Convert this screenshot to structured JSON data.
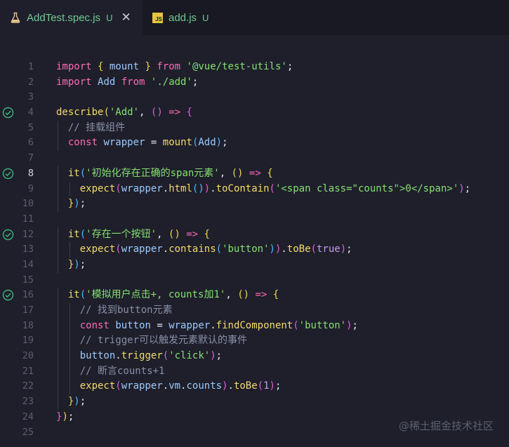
{
  "tabs": [
    {
      "name": "AddTest.spec.js",
      "status": "U",
      "active": true
    },
    {
      "name": "add.js",
      "status": "U",
      "active": false
    }
  ],
  "icons": {
    "test_file": "flask-icon",
    "js_file": "js-file-icon",
    "test_pass": "check-circle-icon",
    "close": "close-icon"
  },
  "js_icon_text": "JS",
  "current_line": 8,
  "lines": [
    {
      "n": "1",
      "t": "import { mount } from '@vue/test-utils';"
    },
    {
      "n": "2",
      "t": "import Add from './add';"
    },
    {
      "n": "3",
      "t": ""
    },
    {
      "n": "4",
      "t": "describe('Add', () => {",
      "pass": true
    },
    {
      "n": "5",
      "t": "  // 挂载组件"
    },
    {
      "n": "6",
      "t": "  const wrapper = mount(Add);"
    },
    {
      "n": "7",
      "t": ""
    },
    {
      "n": "8",
      "t": "  it('初始化存在正确的span元素', () => {",
      "pass": true
    },
    {
      "n": "9",
      "t": "    expect(wrapper.html()).toContain('<span class=\"counts\">0</span>');"
    },
    {
      "n": "10",
      "t": "  });"
    },
    {
      "n": "11",
      "t": ""
    },
    {
      "n": "12",
      "t": "  it('存在一个按钮', () => {",
      "pass": true
    },
    {
      "n": "13",
      "t": "    expect(wrapper.contains('button')).toBe(true);"
    },
    {
      "n": "14",
      "t": "  });"
    },
    {
      "n": "15",
      "t": ""
    },
    {
      "n": "16",
      "t": "  it('模拟用户点击+, counts加1', () => {",
      "pass": true
    },
    {
      "n": "17",
      "t": "    // 找到button元素"
    },
    {
      "n": "18",
      "t": "    const button = wrapper.findComponent('button');"
    },
    {
      "n": "19",
      "t": "    // trigger可以触发元素默认的事件"
    },
    {
      "n": "20",
      "t": "    button.trigger('click');"
    },
    {
      "n": "21",
      "t": "    // 断言counts+1"
    },
    {
      "n": "22",
      "t": "    expect(wrapper.vm.counts).toBe(1);"
    },
    {
      "n": "23",
      "t": "  });"
    },
    {
      "n": "24",
      "t": "});"
    },
    {
      "n": "25",
      "t": ""
    }
  ],
  "watermark": "@稀土掘金技术社区"
}
